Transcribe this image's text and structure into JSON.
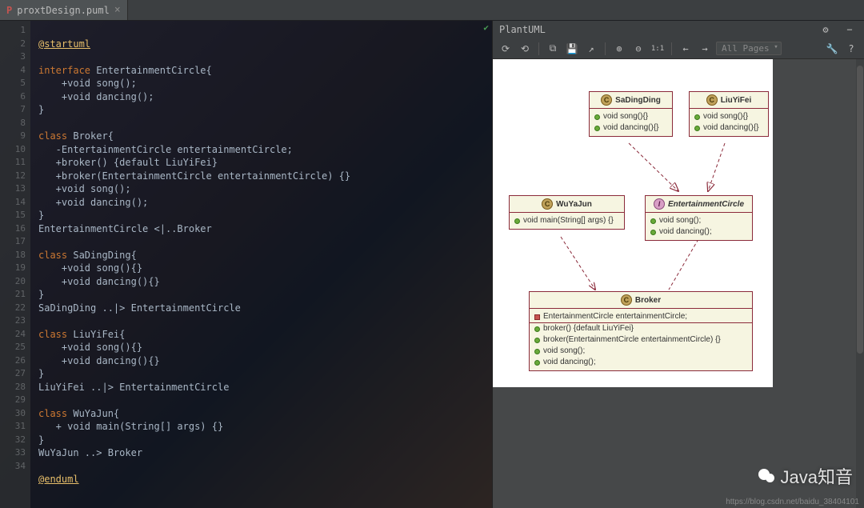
{
  "tab": {
    "filename": "proxtDesign.puml",
    "close": "×"
  },
  "gutter": [
    "1",
    "2",
    "3",
    "4",
    "5",
    "6",
    "7",
    "8",
    "9",
    "10",
    "11",
    "12",
    "13",
    "14",
    "15",
    "16",
    "17",
    "18",
    "19",
    "20",
    "21",
    "22",
    "23",
    "24",
    "25",
    "26",
    "27",
    "28",
    "29",
    "30",
    "31",
    "32",
    "33",
    "34",
    ""
  ],
  "code": {
    "l1": "@startuml",
    "l2": "",
    "l3a": "interface ",
    "l3b": "EntertainmentCircle{",
    "l4": "    +void song();",
    "l5": "    +void dancing();",
    "l6": "}",
    "l7": "",
    "l8a": "class ",
    "l8b": "Broker{",
    "l9": "   -EntertainmentCircle entertainmentCircle;",
    "l10": "   +broker() {default LiuYiFei}",
    "l11": "   +broker(EntertainmentCircle entertainmentCircle) {}",
    "l12": "   +void song();",
    "l13": "   +void dancing();",
    "l14": "}",
    "l15": "EntertainmentCircle <|..Broker",
    "l16": "",
    "l17a": "class ",
    "l17b": "SaDingDing{",
    "l18": "    +void song(){}",
    "l19": "    +void dancing(){}",
    "l20": "}",
    "l21": "SaDingDing ..|> EntertainmentCircle",
    "l22": "",
    "l23a": "class ",
    "l23b": "LiuYiFei{",
    "l24": "    +void song(){}",
    "l25": "    +void dancing(){}",
    "l26": "}",
    "l27": "LiuYiFei ..|> EntertainmentCircle",
    "l28": "",
    "l29a": "class ",
    "l29b": "WuYaJun{",
    "l30": "   + void main(String[] args) {}",
    "l31": "}",
    "l32": "WuYaJun ..> Broker",
    "l33": "",
    "l34": "@enduml"
  },
  "preview": {
    "title": "PlantUML",
    "gear": "⚙",
    "min": "−",
    "toolbar": {
      "refresh": "⟳",
      "sync": "⟲",
      "copy": "⧉",
      "save": "💾",
      "export": "↗",
      "zoomin": "⊕",
      "zoomout": "⊖",
      "oneone": "1:1",
      "prev": "←",
      "next": "→",
      "wrench": "🔧",
      "help": "?"
    },
    "pages": "All Pages"
  },
  "uml": {
    "sadingding": {
      "name": "SaDingDing",
      "m1": "void song(){}",
      "m2": "void dancing(){}"
    },
    "liuyifei": {
      "name": "LiuYiFei",
      "m1": "void song(){}",
      "m2": "void dancing(){}"
    },
    "wuyajun": {
      "name": "WuYaJun",
      "m1": "void main(String[] args) {}"
    },
    "ec": {
      "name": "EntertainmentCircle",
      "m1": "void song();",
      "m2": "void dancing();"
    },
    "broker": {
      "name": "Broker",
      "f1": "EntertainmentCircle entertainmentCircle;",
      "m1": "broker() {default LiuYiFei}",
      "m2": "broker(EntertainmentCircle entertainmentCircle) {}",
      "m3": "void song();",
      "m4": "void dancing();"
    }
  },
  "watermark": "Java知音",
  "footurl": "https://blog.csdn.net/baidu_38404101"
}
